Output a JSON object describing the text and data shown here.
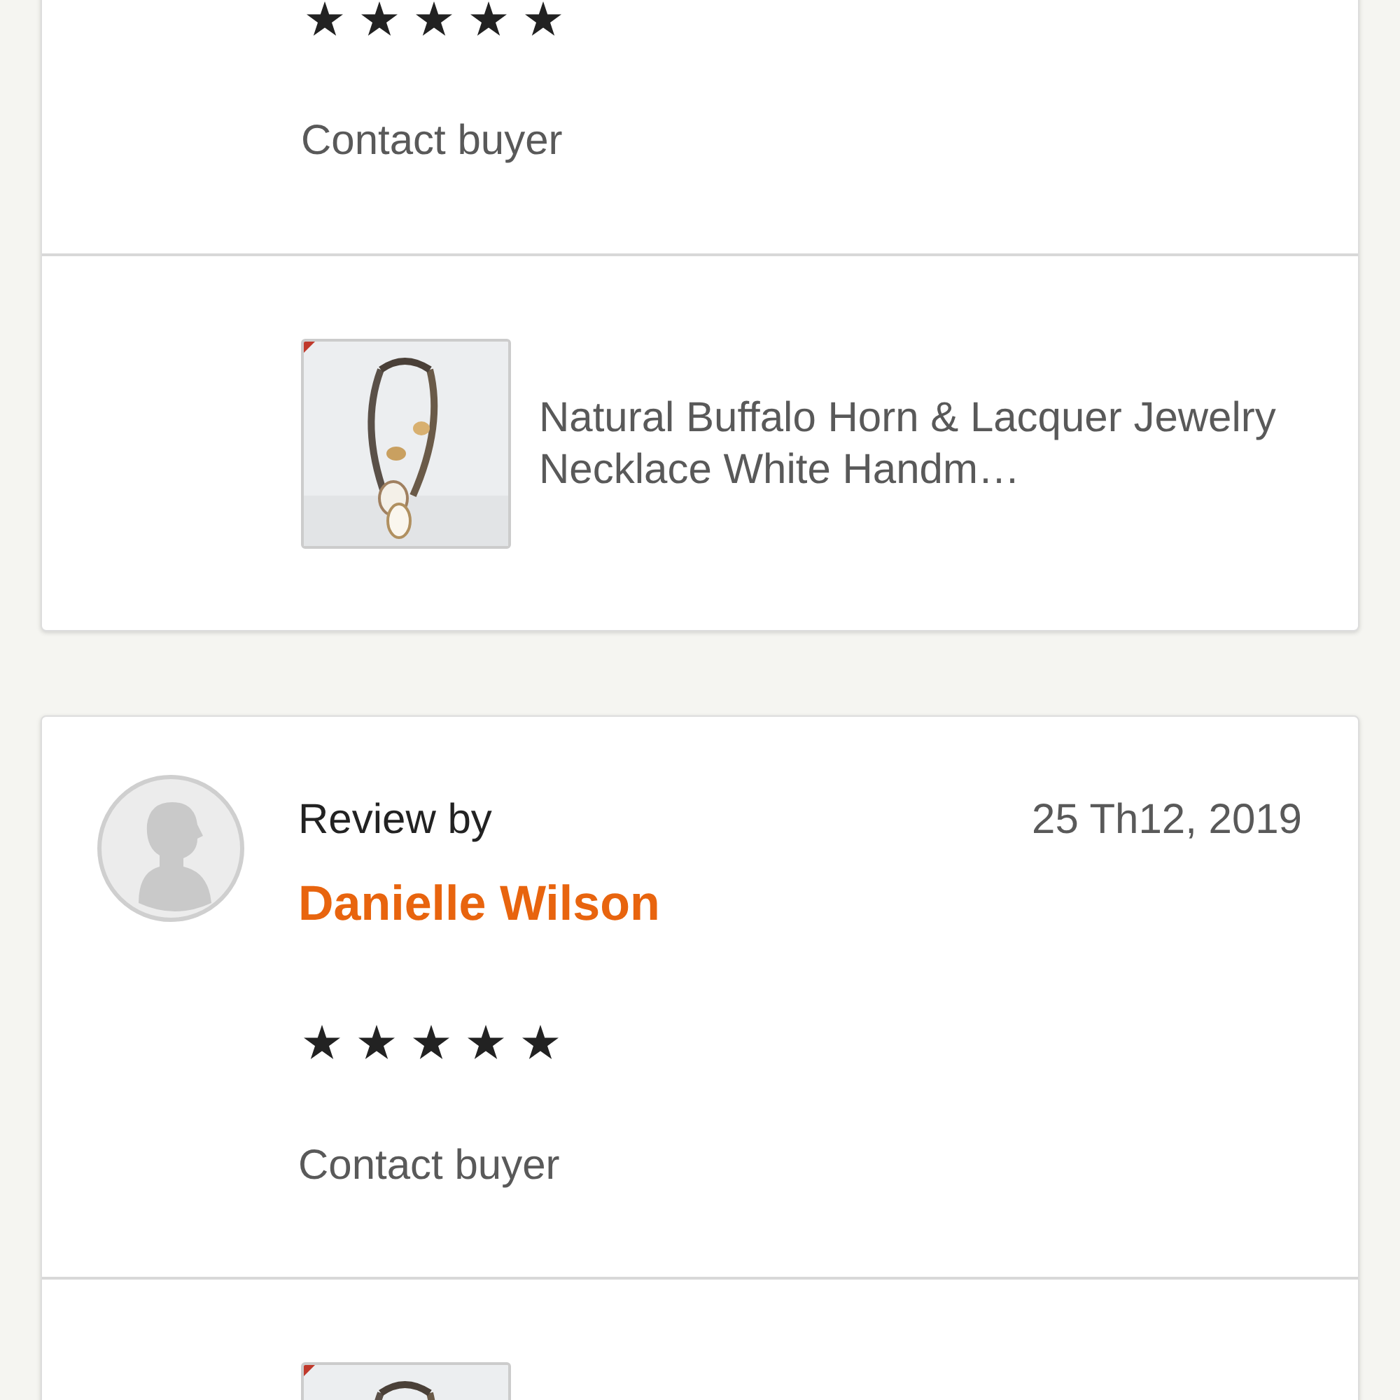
{
  "reviews": [
    {
      "stars": 5,
      "contact_link": "Contact buyer",
      "product": {
        "title": "Natural Buffalo Horn & Lacquer Jewelry Necklace White Handm…"
      }
    },
    {
      "label": "Review by",
      "reviewer": "Danielle Wilson",
      "date": "25 Th12, 2019",
      "stars": 5,
      "contact_link": "Contact buyer"
    }
  ]
}
